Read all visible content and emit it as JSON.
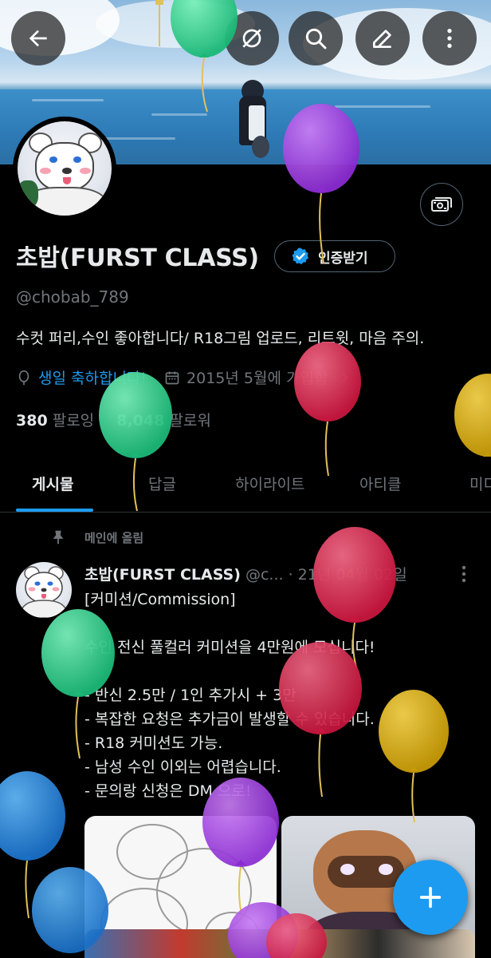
{
  "header": {
    "back_icon": "arrow-left-icon",
    "actions": [
      "grok-icon",
      "search-icon",
      "edit-icon",
      "more-vertical-icon"
    ]
  },
  "profile": {
    "name": "초밥(FURST CLASS)",
    "verify_label": "인증받기",
    "handle": "@chobab_789",
    "bio": "수컷 퍼리,수인 좋아합니다/ R18그림 업로드, 리트윗, 마음 주의.",
    "birthday": "생일 축하합니다!",
    "joined": "2015년 5월에 가입함",
    "following_count": "380",
    "following_label": "팔로잉",
    "followers_count": "8,048",
    "followers_label": "팔로워"
  },
  "tabs": [
    {
      "label": "게시물",
      "active": true
    },
    {
      "label": "답글",
      "active": false
    },
    {
      "label": "하이라이트",
      "active": false
    },
    {
      "label": "아티클",
      "active": false
    },
    {
      "label": "미디",
      "active": false
    }
  ],
  "pinned_post": {
    "pinned_label": "메인에 올림",
    "author_name": "초밥(FURST CLASS)",
    "author_handle": "@c...",
    "date": "· 21년 04월 02일",
    "lines": [
      "[커미션/Commission]",
      "",
      "수인 전신 풀컬러 커미션을 4만원에 모십니다!",
      "",
      "- 반신 2.5만 / 1인 추가시 + 3만",
      "- 복잡한 요청은 추가금이 발생할 수 있습니다.",
      "- R18 커미션도 가능.",
      "- 남성 수인 이외는 어렵습니다.",
      "- 문의랑 신청은 DM 으로!"
    ]
  },
  "colors": {
    "accent": "#1d9bf0",
    "background": "#000000",
    "muted_text": "#71767b",
    "text": "#e7e9ea"
  },
  "fab_icon": "plus-icon"
}
